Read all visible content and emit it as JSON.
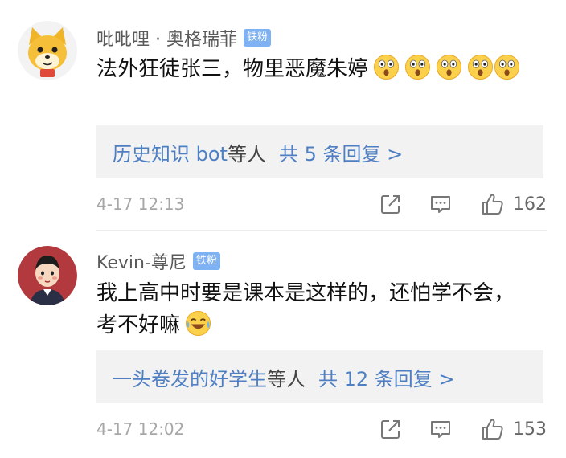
{
  "comments": [
    {
      "user": "吡吡哩 · 奥格瑞菲",
      "badge": "铁粉",
      "text": "法外狂徒张三，物里恶魔朱婷",
      "emoji_icon": "astonished-face-icon",
      "emoji_count": 5,
      "reply_names": "历史知识 bot",
      "reply_suffix": "等人",
      "reply_count": "共 5 条回复 >",
      "time": "4-17 12:13",
      "likes": "162"
    },
    {
      "user": "Kevin-尊尼",
      "badge": "铁粉",
      "text": "我上高中时要是课本是这样的，还怕学不会，考不好嘛",
      "emoji_icon": "laughing-crying-face-icon",
      "emoji_count": 1,
      "reply_names": "一头卷发的好学生",
      "reply_suffix": "等人",
      "reply_count": "共 12 条回复 >",
      "time": "4-17 12:02",
      "likes": "153"
    }
  ],
  "colors": {
    "link": "#4f7fc3",
    "badge": "#7fb2f2",
    "reply_bg": "#f2f2f2",
    "meta_text": "#a7a7a7"
  },
  "icons": [
    "share-icon",
    "comment-icon",
    "thumbs-up-icon"
  ]
}
